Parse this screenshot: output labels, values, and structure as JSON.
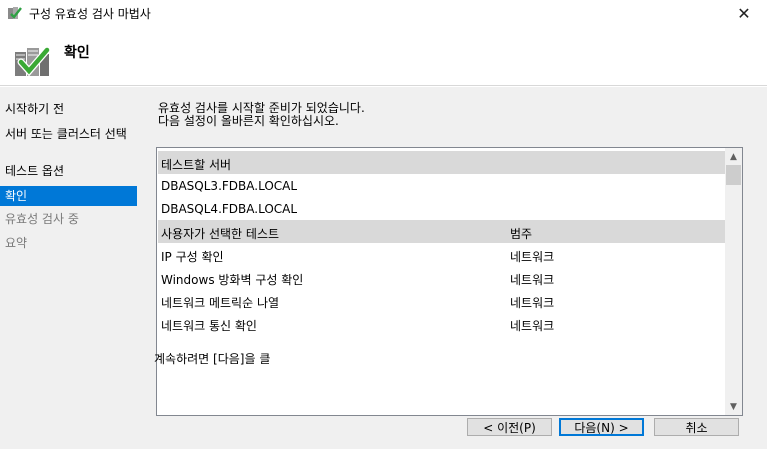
{
  "window": {
    "title": "구성 유효성 검사 마법사",
    "close_icon": "close-icon"
  },
  "header": {
    "title": "확인",
    "icon": "wizard-check-icon"
  },
  "sidebar": {
    "steps": [
      {
        "label": "시작하기 전",
        "state": "normal"
      },
      {
        "label": "서버 또는 클러스터 선택",
        "state": "normal"
      },
      {
        "label": "테스트 옵션",
        "state": "normal"
      },
      {
        "label": "확인",
        "state": "current"
      },
      {
        "label": "유효성 검사 중",
        "state": "disabled"
      },
      {
        "label": "요약",
        "state": "disabled"
      }
    ]
  },
  "main": {
    "intro_line1": "유효성 검사를 시작할 준비가 되었습니다.",
    "intro_line2": "다음 설정이 올바른지 확인하십시오.",
    "list": {
      "servers_header": "테스트할 서버",
      "servers": [
        "DBASQL3.FDBA.LOCAL",
        "DBASQL4.FDBA.LOCAL"
      ],
      "tests_header": "사용자가 선택한 테스트",
      "category_header": "범주",
      "tests": [
        {
          "name": "IP 구성 확인",
          "category": "네트워크"
        },
        {
          "name": "Windows 방화벽 구성 확인",
          "category": "네트워크"
        },
        {
          "name": "네트워크 메트릭순 나열",
          "category": "네트워크"
        },
        {
          "name": "네트워크 통신 확인",
          "category": "네트워크"
        }
      ]
    },
    "hint": "계속하려면 [다음]을 클"
  },
  "buttons": {
    "back": "< 이전(P)",
    "next": "다음(N) >",
    "cancel": "취소"
  },
  "colors": {
    "accent": "#0078d7",
    "group_row": "#d9d9d9",
    "panel": "#f0f0f0"
  }
}
